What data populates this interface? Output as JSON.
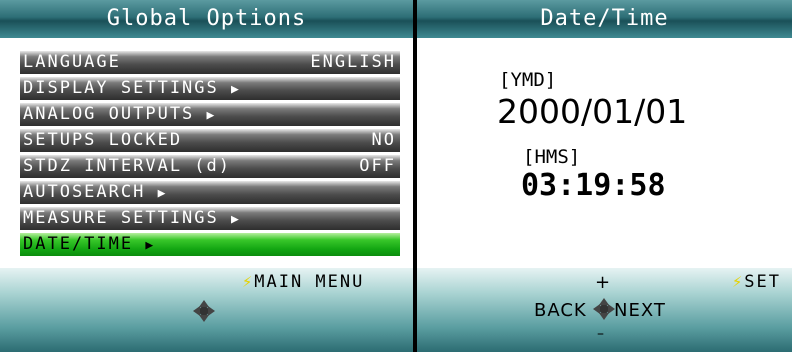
{
  "global_options": {
    "title": "Global Options",
    "items": [
      {
        "label": "LANGUAGE",
        "value": "ENGLISH",
        "arrow": ""
      },
      {
        "label": "DISPLAY SETTINGS",
        "value": "",
        "arrow": "▶"
      },
      {
        "label": "ANALOG OUTPUTS",
        "value": "",
        "arrow": "▶"
      },
      {
        "label": "SETUPS LOCKED",
        "value": "NO",
        "arrow": ""
      },
      {
        "label": "STDZ INTERVAL (d)",
        "value": "OFF",
        "arrow": ""
      },
      {
        "label": "AUTOSEARCH",
        "value": "",
        "arrow": "▶"
      },
      {
        "label": "MEASURE SETTINGS",
        "value": "",
        "arrow": "▶"
      },
      {
        "label": "DATE/TIME",
        "value": "",
        "arrow": "▶"
      }
    ],
    "selected_index": 7,
    "softkey_label": "MAIN MENU",
    "softkey_icon": "lightning-bolt-icon",
    "nav_icon": "dpad-icon"
  },
  "date_time": {
    "title": "Date/Time",
    "date_format_label": "[YMD]",
    "date_value": "2000/01/01",
    "time_format_label": "[HMS]",
    "time_value": "03:19:5",
    "time_last_digit": "8",
    "nav_plus": "+",
    "nav_minus": "–",
    "back_label": "BACK",
    "next_label": "NEXT",
    "softkey_label": "SET",
    "softkey_icon": "lightning-bolt-icon"
  },
  "colors": {
    "title_bar": "#2d6e76",
    "row_normal": "#4b4b4b",
    "row_selected": "#13a612",
    "bolt": "#e6d200"
  }
}
